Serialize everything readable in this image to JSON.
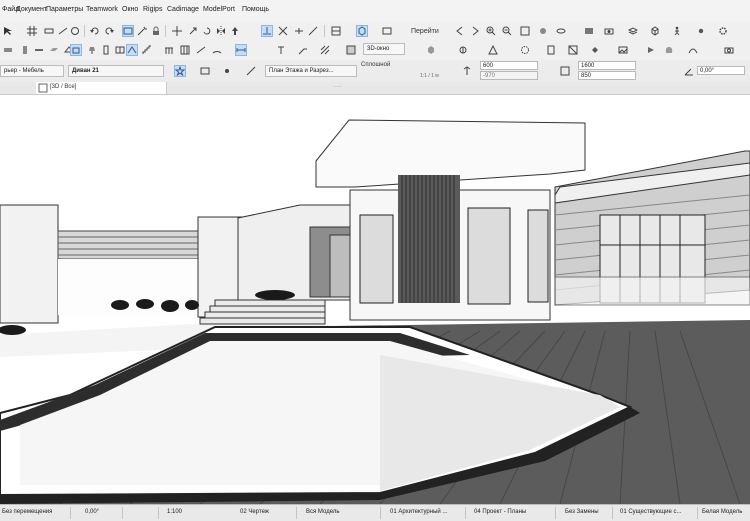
{
  "menubar": {
    "items": [
      "Файл",
      "Документ",
      "Параметры",
      "Teamwork",
      "Окно",
      "Rigips",
      "Cadimage",
      "ModelPort",
      "Помощь"
    ]
  },
  "toolbar": {
    "view_3d_label": "3D-окно",
    "goto_label": "Перейти"
  },
  "infobox": {
    "layer_value": "рьер - Мебель",
    "object_name": "Диван 21",
    "floor_plan_value": "План Этажа и Разрез...",
    "structure_label": "Сплошной",
    "ratio_text": "1:1 / 1 м",
    "dim_top": "600",
    "dim_bottom": "-970",
    "size_top": "1600",
    "size_bottom": "850",
    "angle_value": "0,00°"
  },
  "tabbar": {
    "tab_label": "[3D / Все]",
    "handle": "....."
  },
  "statusbar": {
    "items": [
      "Без перемещения",
      "0,00°",
      "02 Чертеж",
      "1:100",
      "Вся Модель",
      "01 Архитектурный ...",
      "04 Проект - Планы",
      "Без Замены",
      "01 Существующие с...",
      "Белая Модель"
    ]
  },
  "colors": {
    "menubar_bg": "#f3f3f3",
    "toolbar_bg": "#f0f0f0",
    "active_blue": "#c7dcf3",
    "viewport_bg": "#ffffff"
  }
}
